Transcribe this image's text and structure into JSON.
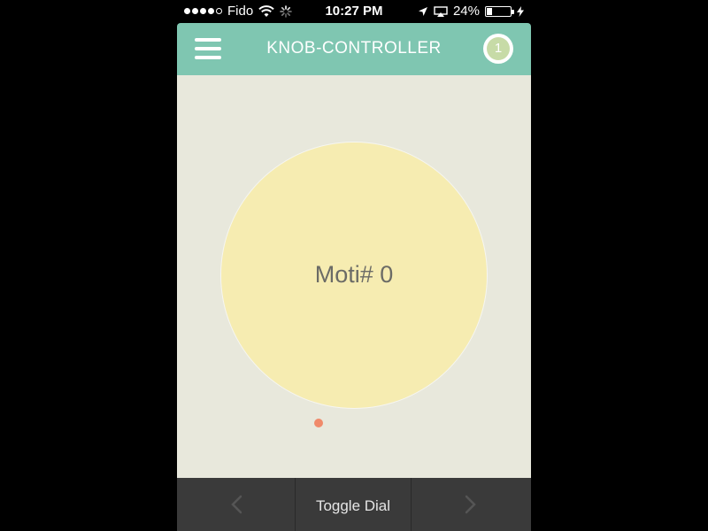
{
  "status_bar": {
    "carrier": "Fido",
    "time": "10:27 PM",
    "battery_percent": "24%",
    "battery_level": 0.24,
    "signal_bars_filled": 4,
    "signal_bars_total": 5
  },
  "header": {
    "title": "KNOB-CONTROLLER",
    "badge_count": "1",
    "menu_icon": "hamburger-menu-icon"
  },
  "dial": {
    "label": "Moti# 0",
    "indicator_color": "#f08a6a"
  },
  "toolbar": {
    "prev_icon": "chevron-left-icon",
    "toggle_label": "Toggle Dial",
    "next_icon": "chevron-right-icon"
  },
  "colors": {
    "header_bg": "#7fc6b1",
    "content_bg": "#e8e8dc",
    "dial_bg": "#f6ecb1",
    "toolbar_bg": "#3a3a3a"
  }
}
